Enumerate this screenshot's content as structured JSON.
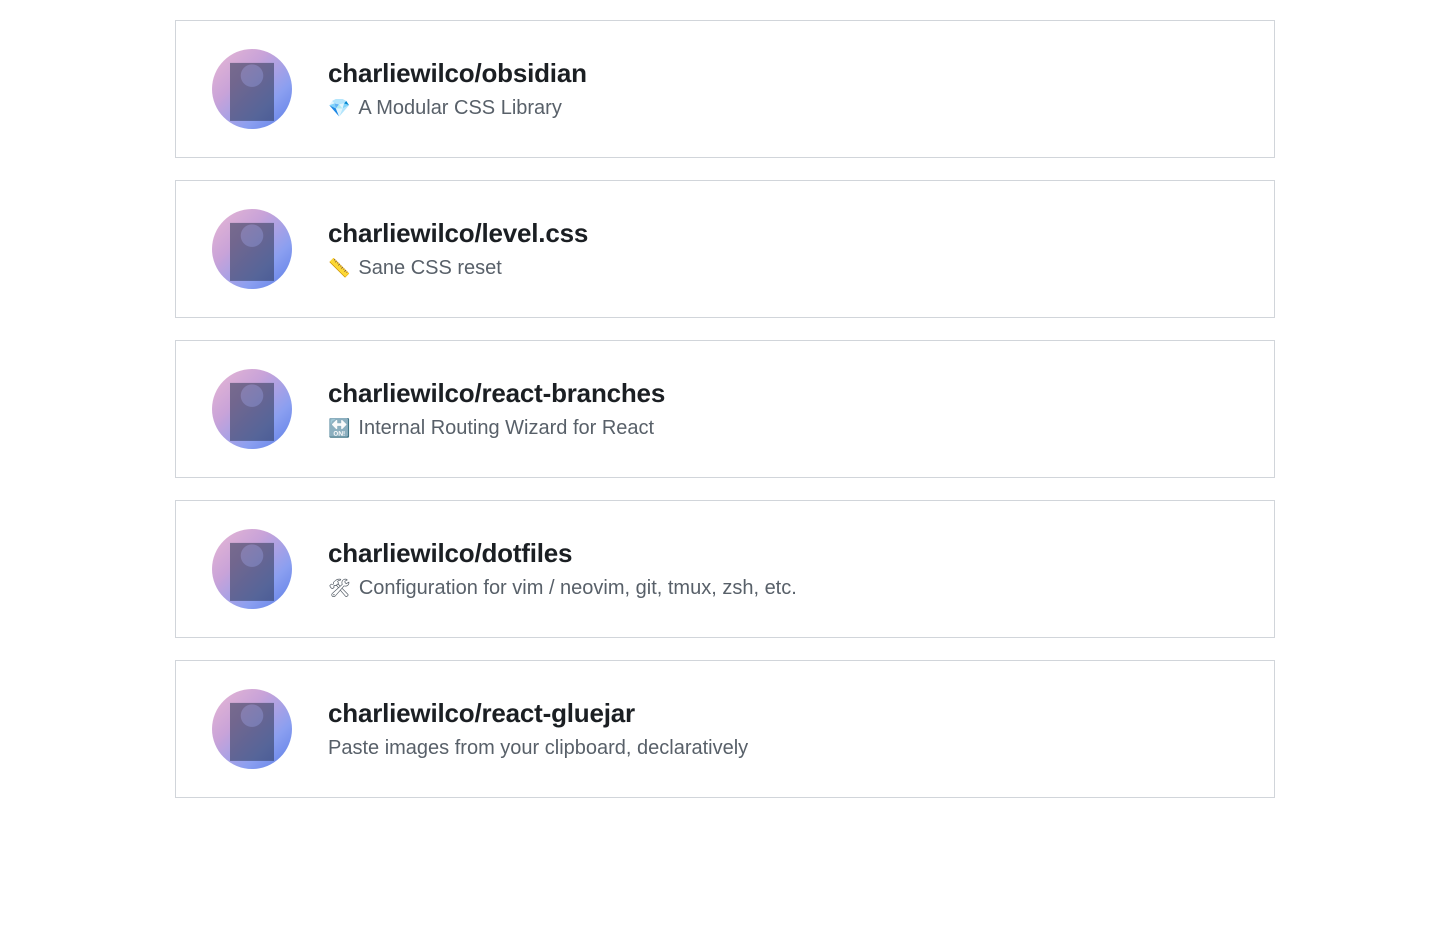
{
  "repos": [
    {
      "title": "charliewilco/obsidian",
      "emoji": "💎",
      "description": "A Modular CSS Library"
    },
    {
      "title": "charliewilco/level.css",
      "emoji": "📏",
      "description": "Sane CSS reset"
    },
    {
      "title": "charliewilco/react-branches",
      "emoji": "🔛",
      "description": "Internal Routing Wizard for React"
    },
    {
      "title": "charliewilco/dotfiles",
      "emoji": "🛠",
      "description": "Configuration for vim / neovim, git, tmux, zsh, etc."
    },
    {
      "title": "charliewilco/react-gluejar",
      "emoji": "",
      "description": "Paste images from your clipboard, declaratively"
    }
  ]
}
